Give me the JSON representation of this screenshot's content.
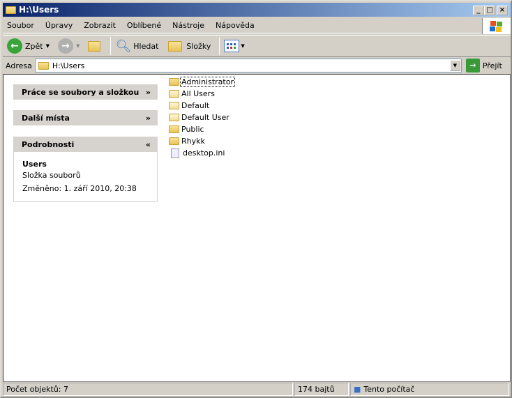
{
  "window": {
    "title": "H:\\Users"
  },
  "menu": [
    "Soubor",
    "Úpravy",
    "Zobrazit",
    "Oblíbené",
    "Nástroje",
    "Nápověda"
  ],
  "toolbar": {
    "back": "Zpět",
    "search": "Hledat",
    "folders": "Složky"
  },
  "address": {
    "label": "Adresa",
    "value": "H:\\Users",
    "go": "Přejít"
  },
  "panels": {
    "tasks": "Práce se soubory a složkou",
    "places": "Další místa",
    "details": {
      "title": "Podrobnosti",
      "name": "Users",
      "type": "Složka souborů",
      "modified": "Změněno: 1. září 2010, 20:38"
    }
  },
  "files": [
    {
      "name": "Administrator",
      "icon": "folder"
    },
    {
      "name": "All Users",
      "icon": "folder-light"
    },
    {
      "name": "Default",
      "icon": "folder-light"
    },
    {
      "name": "Default User",
      "icon": "folder-light"
    },
    {
      "name": "Public",
      "icon": "folder"
    },
    {
      "name": "Rhykk",
      "icon": "folder"
    },
    {
      "name": "desktop.ini",
      "icon": "ini-file"
    }
  ],
  "status": {
    "count": "Počet objektů: 7",
    "size": "174 bajtů",
    "zone": "Tento počítač"
  }
}
